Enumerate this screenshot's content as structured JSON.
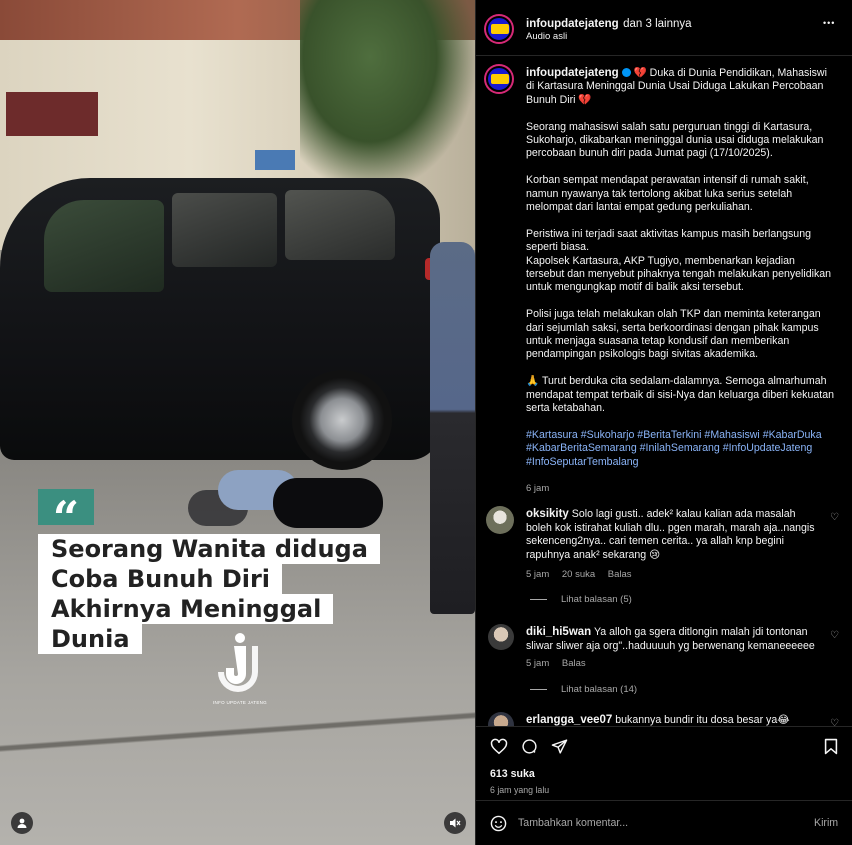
{
  "video": {
    "headline_lines": [
      "Seorang Wanita diduga",
      "Coba Bunuh Diri",
      "Akhirnya Meninggal",
      "Dunia"
    ],
    "quote_glyph": "“",
    "logo_text": "INFO UPDATE JATENG"
  },
  "header": {
    "username": "infoupdatejateng",
    "collab": "dan 3 lainnya",
    "audio": "Audio asli",
    "more": "•••"
  },
  "caption": {
    "username": "infoupdatejateng",
    "paragraphs": [
      "💔 Duka di Dunia Pendidikan, Mahasiswi di Kartasura Meninggal Dunia Usai Diduga Lakukan Percobaan Bunuh Diri 💔",
      "Seorang mahasiswi salah satu perguruan tinggi di Kartasura, Sukoharjo, dikabarkan meninggal dunia usai diduga melakukan percobaan bunuh diri pada Jumat pagi (17/10/2025).",
      "Korban sempat mendapat perawatan intensif di rumah sakit, namun nyawanya tak tertolong akibat luka serius setelah melompat dari lantai empat gedung perkuliahan.",
      "Peristiwa ini terjadi saat aktivitas kampus masih berlangsung seperti biasa.",
      "Kapolsek Kartasura, AKP Tugiyo, membenarkan kejadian tersebut dan menyebut pihaknya tengah melakukan penyelidikan untuk mengungkap motif di balik aksi tersebut.",
      "Polisi juga telah melakukan olah TKP dan meminta keterangan dari sejumlah saksi, serta berkoordinasi dengan pihak kampus untuk menjaga suasana tetap kondusif dan memberikan pendampingan psikologis bagi sivitas akademika.",
      "🙏 Turut berduka cita sedalam-dalamnya. Semoga almarhumah mendapat tempat terbaik di sisi-Nya dan keluarga diberi kekuatan serta ketabahan."
    ],
    "hashtags": "#Kartasura #Sukoharjo #BeritaTerkini #Mahasiswi #KabarDuka #KabarBeritaSemarang #InilahSemarang #InfoUpdateJateng #InfoSeputarTembalang",
    "time": "6 jam"
  },
  "comments": [
    {
      "username": "oksikity",
      "text": "Solo lagi gusti.. adek² kalau kalian ada masalah boleh kok istirahat kuliah dlu.. pgen marah, marah aja..nangis sekenceng2nya.. cari temen cerita.. ya allah knp begini rapuhnya anak² sekarang 😢",
      "time": "5 jam",
      "likes": "20 suka",
      "reply": "Balas",
      "view_replies": "Lihat balasan (5)"
    },
    {
      "username": "diki_hi5wan",
      "text": "Ya alloh ga sgera ditlongin malah jdi tontonan sliwar sliwer aja org\"..haduuuuh yg berwenang kemaneeeeee",
      "time": "5 jam",
      "reply": "Balas",
      "view_replies": "Lihat balasan (14)"
    },
    {
      "username": "erlangga_vee07",
      "text": "bukannya bundir itu dosa besar ya😂"
    }
  ],
  "actions": {
    "likes": "613 suka",
    "posted": "6 jam yang lalu"
  },
  "add_comment": {
    "placeholder": "Tambahkan komentar...",
    "post": "Kirim"
  },
  "colors": {
    "hashtag": "#8ab4f8",
    "muted": "#a8a8a8",
    "quote_box": "#3b8f80"
  }
}
